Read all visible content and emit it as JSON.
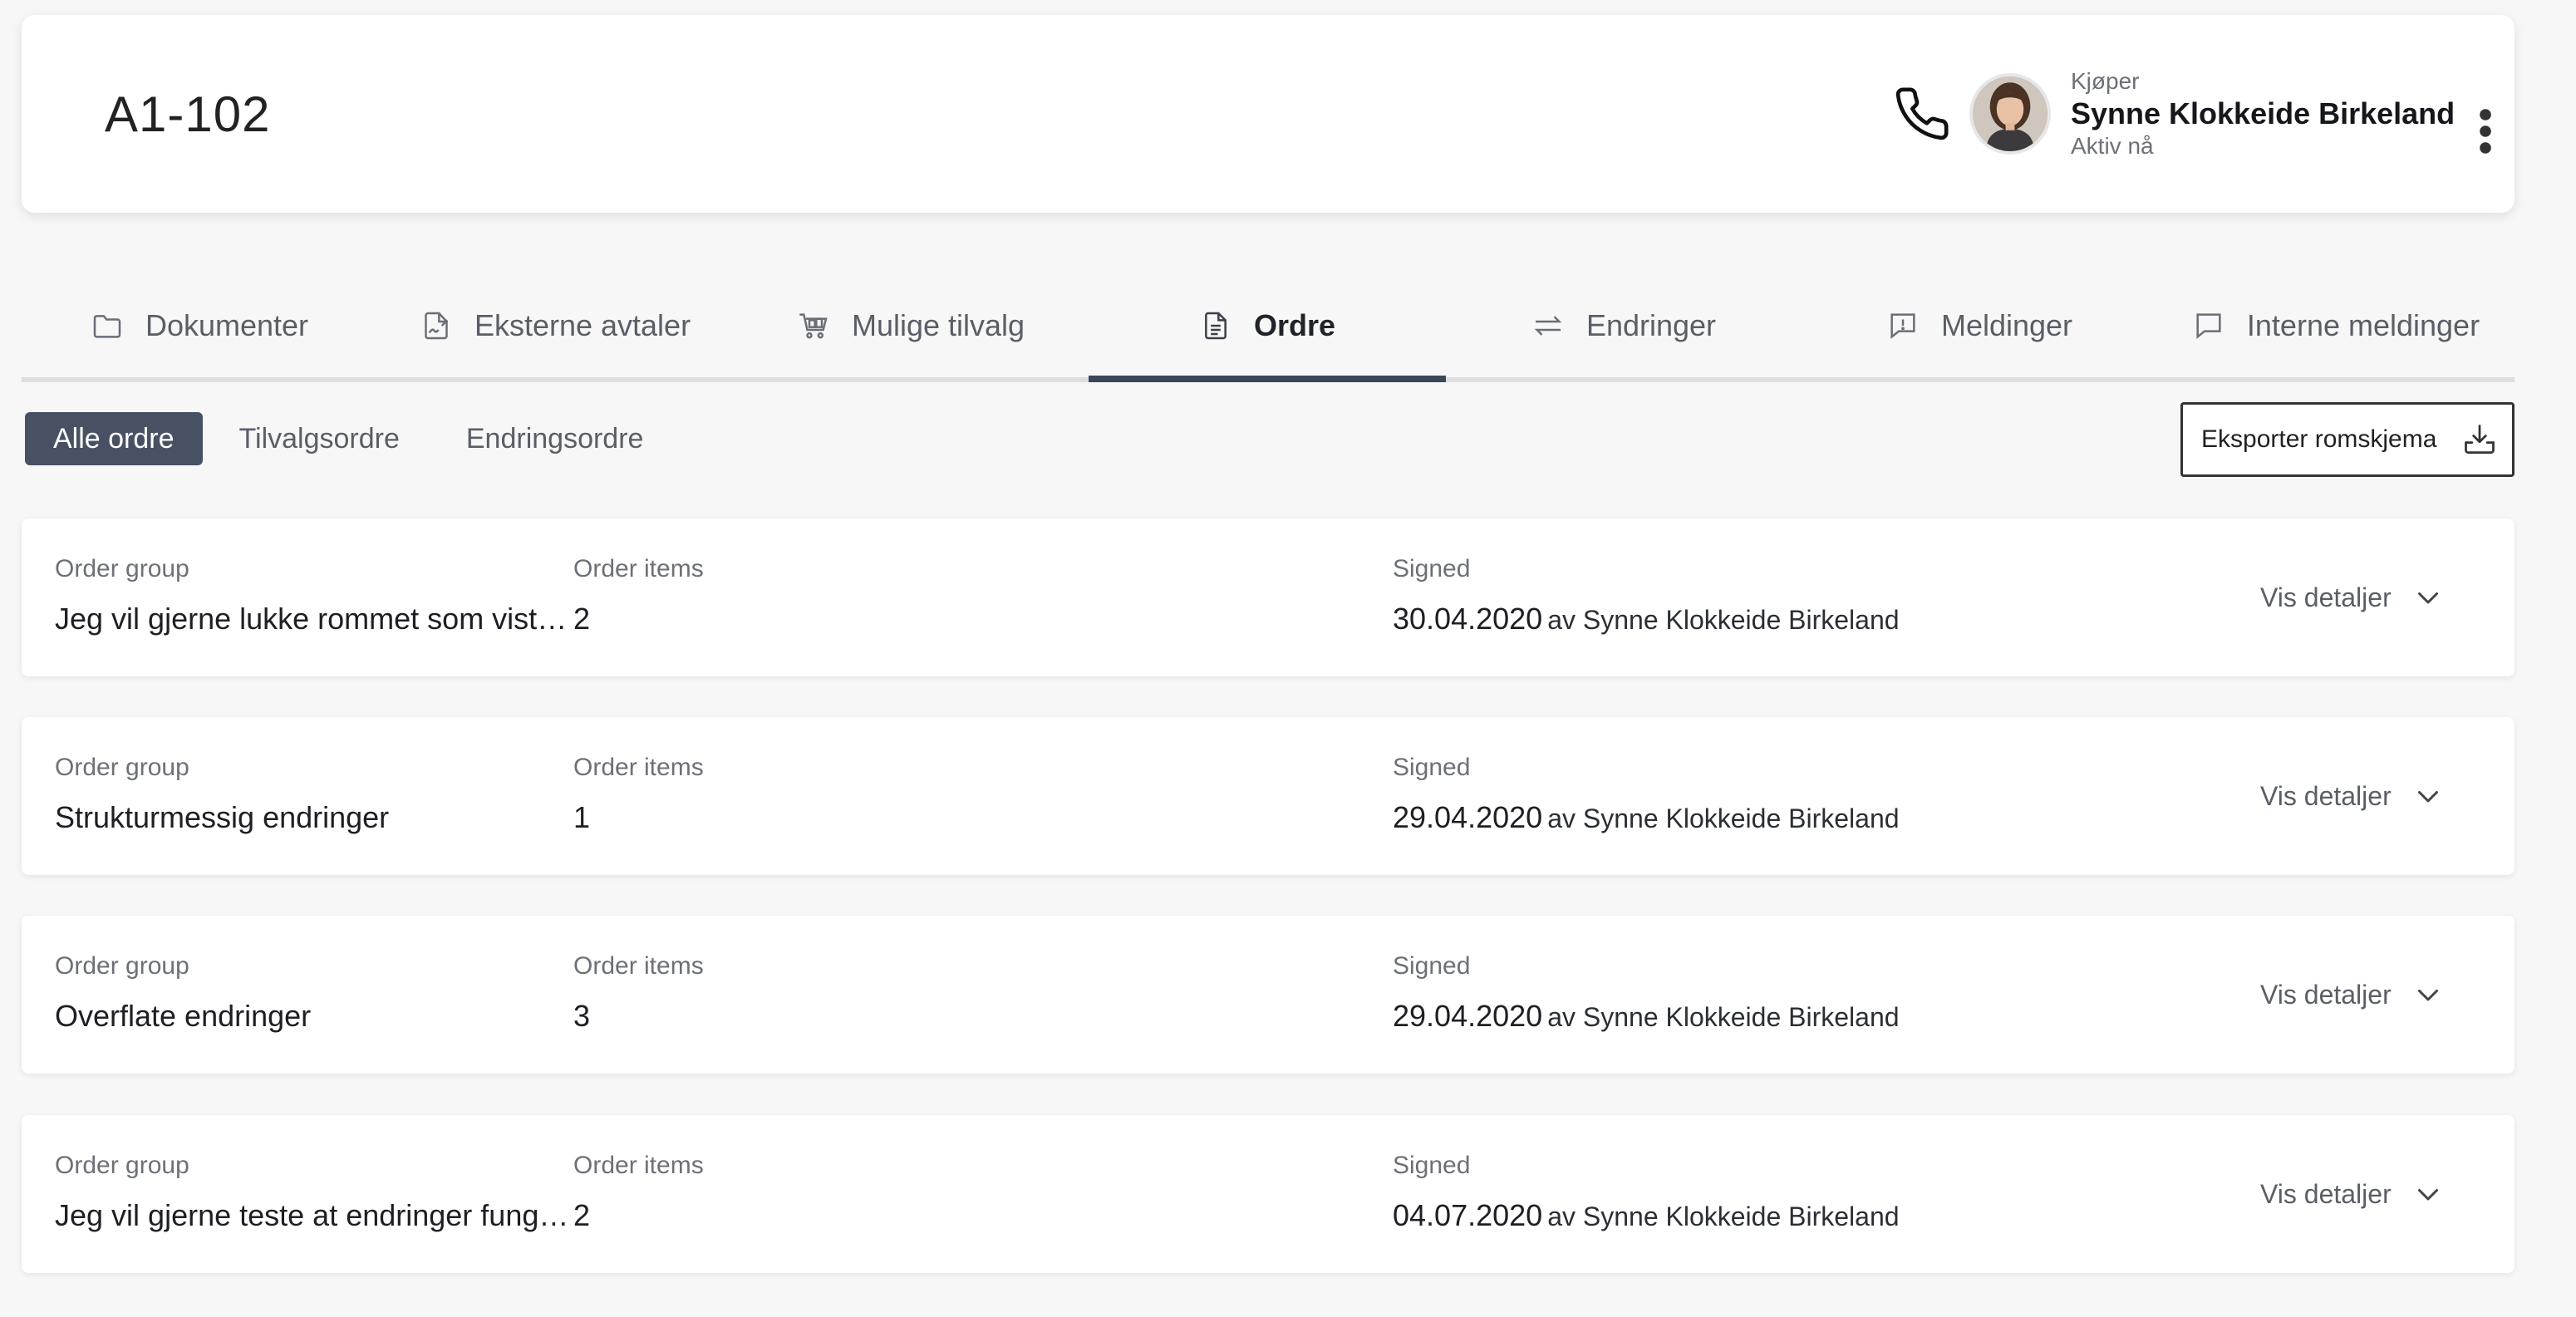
{
  "header": {
    "unit_title": "A1-102",
    "buyer_role": "Kjøper",
    "buyer_name": "Synne Klokkeide Birkeland",
    "buyer_status": "Aktiv nå"
  },
  "tabs": [
    {
      "label": "Dokumenter",
      "icon": "folder-icon"
    },
    {
      "label": "Eksterne avtaler",
      "icon": "signed-document-icon"
    },
    {
      "label": "Mulige tilvalg",
      "icon": "cart-icon"
    },
    {
      "label": "Ordre",
      "icon": "document-icon",
      "active": true
    },
    {
      "label": "Endringer",
      "icon": "swap-arrows-icon"
    },
    {
      "label": "Meldinger",
      "icon": "alert-message-icon"
    },
    {
      "label": "Interne meldinger",
      "icon": "chat-icon"
    }
  ],
  "filters": {
    "all": "Alle ordre",
    "option": "Tilvalgsordre",
    "change": "Endringsordre"
  },
  "export_label": "Eksporter romskjema",
  "columns": {
    "group": "Order group",
    "items": "Order items",
    "signed": "Signed"
  },
  "details_label": "Vis detaljer",
  "orders": [
    {
      "group": "Jeg vil gjerne lukke rommet som vist i tegningen",
      "items": "2",
      "date": "30.04.2020",
      "by": "av Synne Klokkeide Birkeland"
    },
    {
      "group": "Strukturmessig endringer",
      "items": "1",
      "date": "29.04.2020",
      "by": "av Synne Klokkeide Birkeland"
    },
    {
      "group": "Overflate endringer",
      "items": "3",
      "date": "29.04.2020",
      "by": "av Synne Klokkeide Birkeland"
    },
    {
      "group": "Jeg vil gjerne teste at endringer fungerer",
      "items": "2",
      "date": "04.07.2020",
      "by": "av Synne Klokkeide Birkeland"
    }
  ],
  "colors": {
    "active_chip": "#485163",
    "tab_indicator": "#3c4658",
    "background": "#f7f7f8"
  }
}
